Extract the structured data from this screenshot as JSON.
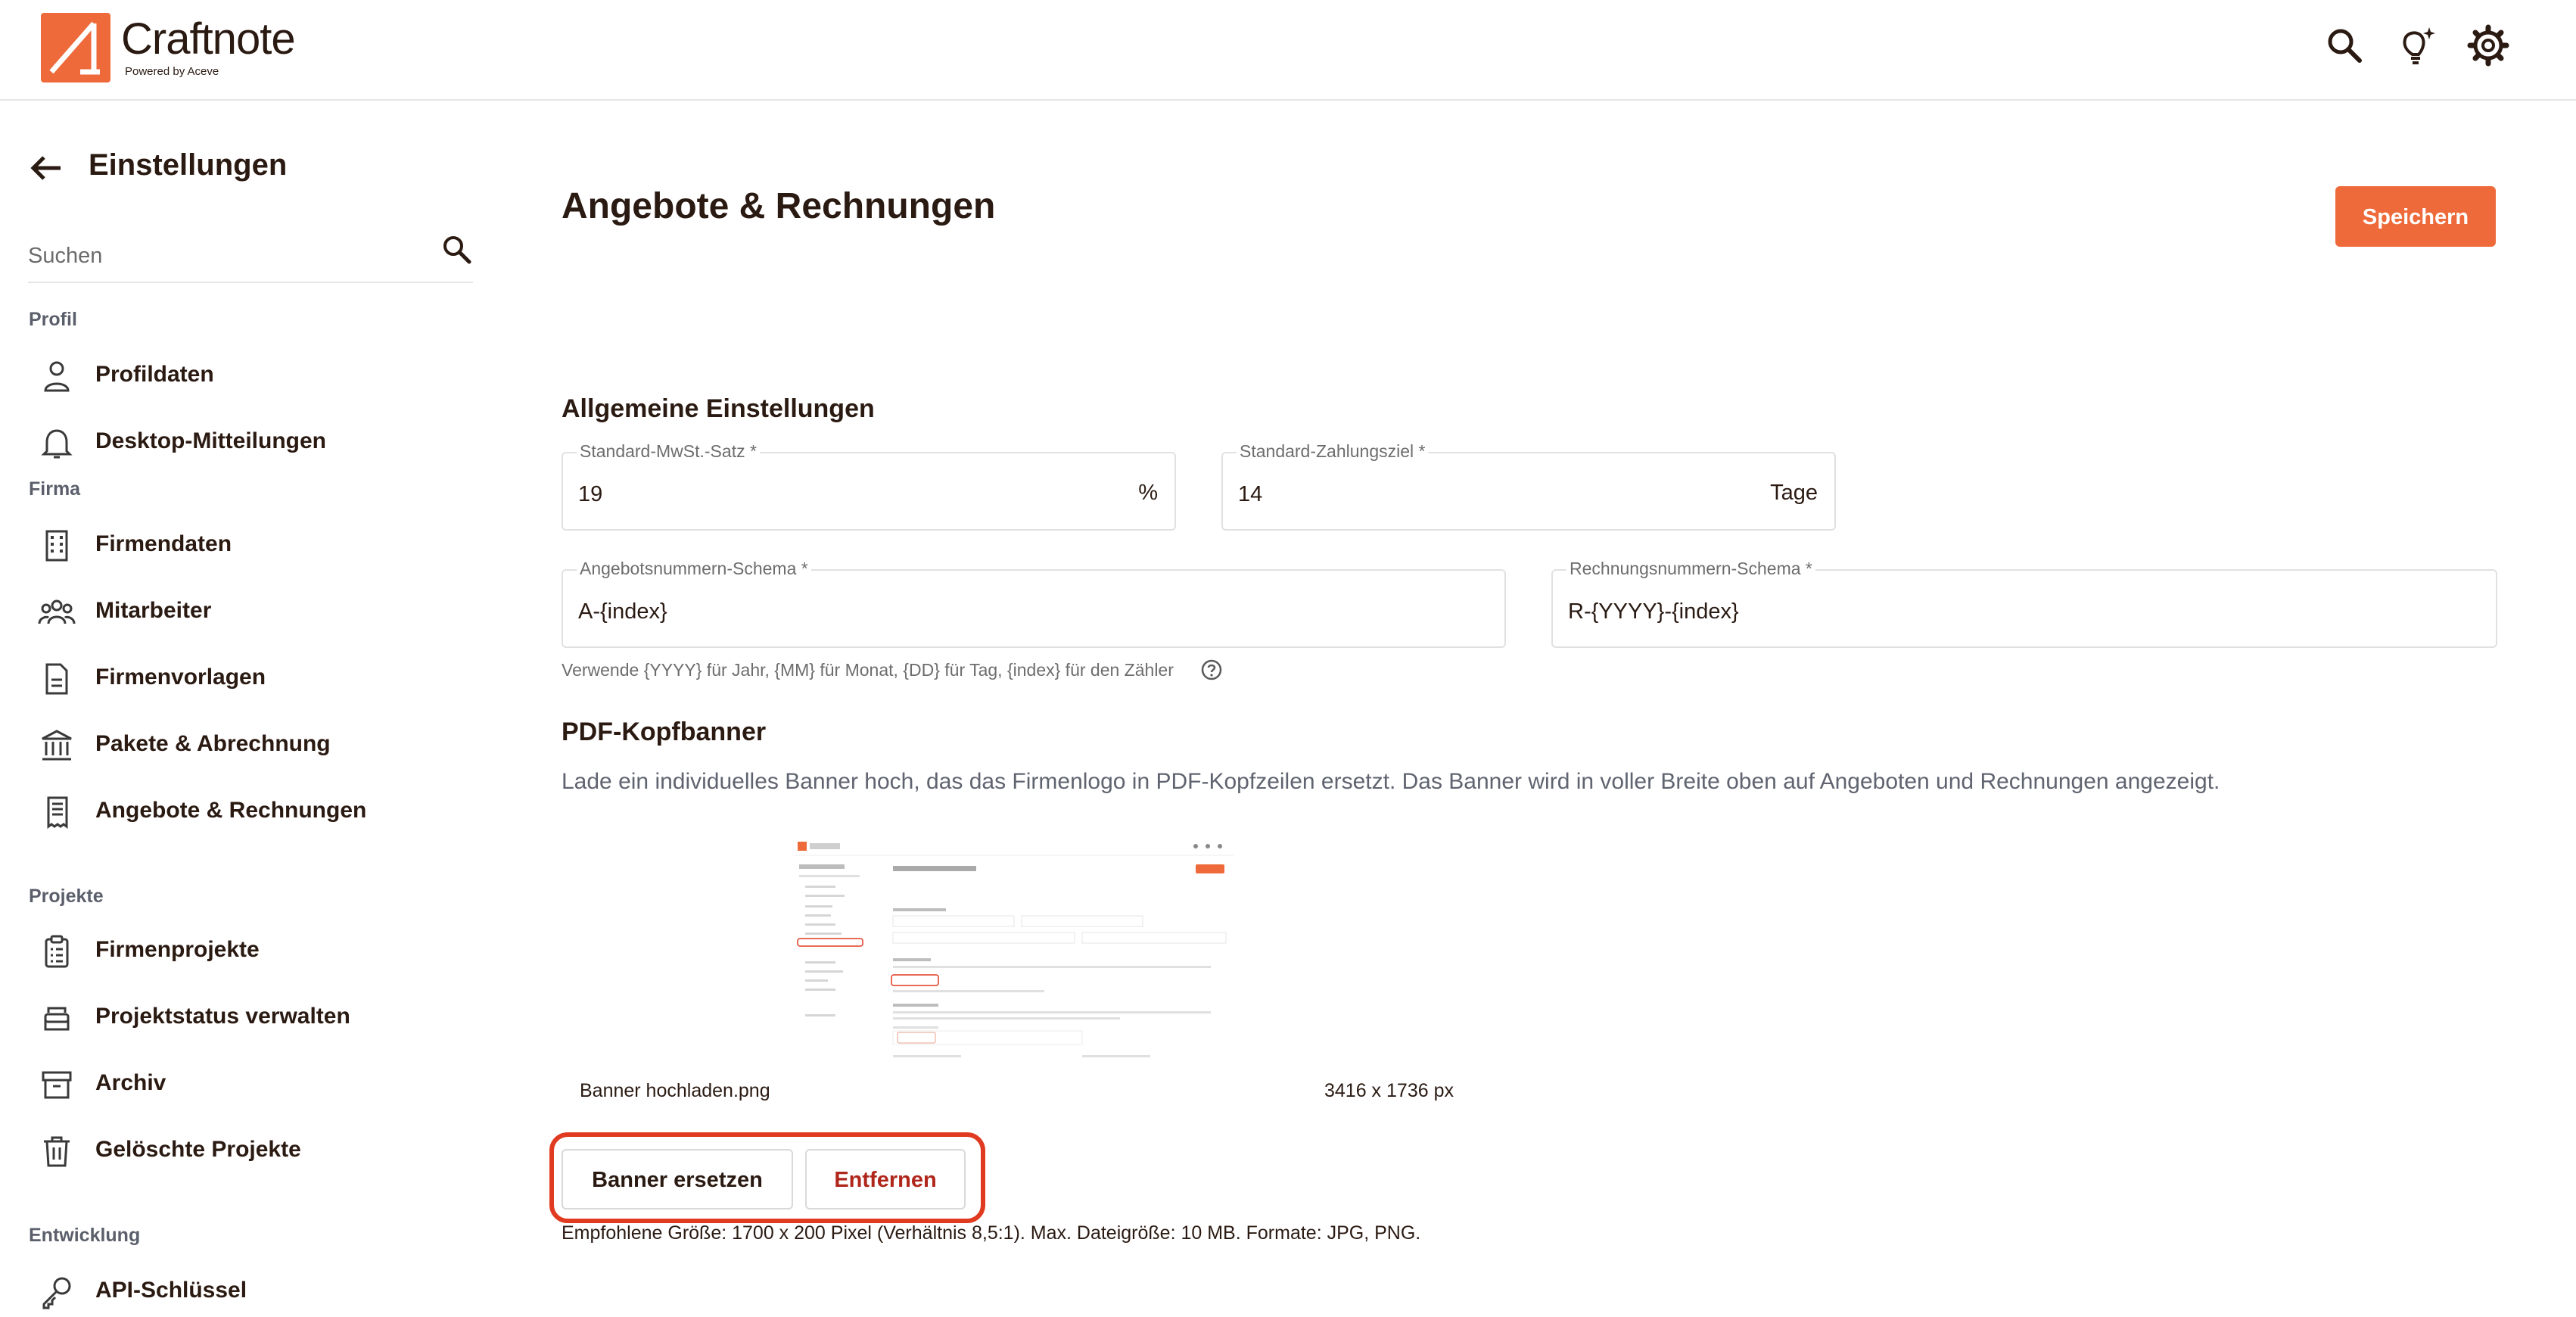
{
  "header": {
    "app_name": "Craftnote",
    "app_subtitle": "Powered by Aceve",
    "icons": [
      "search-icon",
      "lightbulb-icon",
      "gear-icon"
    ]
  },
  "sidebar": {
    "title": "Einstellungen",
    "search_placeholder": "Suchen",
    "sections": {
      "profil": "Profil",
      "firma": "Firma",
      "projekte": "Projekte",
      "entwicklung": "Entwicklung"
    },
    "items": [
      {
        "label": "Profildaten",
        "icon": "user-icon"
      },
      {
        "label": "Desktop-Mitteilungen",
        "icon": "bell-icon"
      },
      {
        "label": "Firmendaten",
        "icon": "building-icon"
      },
      {
        "label": "Mitarbeiter",
        "icon": "team-icon"
      },
      {
        "label": "Firmenvorlagen",
        "icon": "document-icon"
      },
      {
        "label": "Pakete & Abrechnung",
        "icon": "bank-icon"
      },
      {
        "label": "Angebote & Rechnungen",
        "icon": "receipt-icon"
      },
      {
        "label": "Firmenprojekte",
        "icon": "clipboard-icon"
      },
      {
        "label": "Projektstatus verwalten",
        "icon": "stack-icon"
      },
      {
        "label": "Archiv",
        "icon": "archive-icon"
      },
      {
        "label": "Gelöschte Projekte",
        "icon": "trash-icon"
      },
      {
        "label": "API-Schlüssel",
        "icon": "key-icon"
      }
    ]
  },
  "main": {
    "title": "Angebote & Rechnungen",
    "save_label": "Speichern",
    "general": {
      "heading": "Allgemeine Einstellungen",
      "vat_label": "Standard-MwSt.-Satz *",
      "vat_value": "19",
      "vat_suffix": "%",
      "payment_label": "Standard-Zahlungsziel *",
      "payment_value": "14",
      "payment_suffix": "Tage",
      "offer_schema_label": "Angebotsnummern-Schema *",
      "offer_schema_value": "A-{index}",
      "invoice_schema_label": "Rechnungsnummern-Schema *",
      "invoice_schema_value": "R-{YYYY}-{index}",
      "hint": "Verwende {YYYY} für Jahr, {MM} für Monat, {DD} für Tag, {index} für den Zähler"
    },
    "banner": {
      "heading": "PDF-Kopfbanner",
      "description": "Lade ein individuelles Banner hoch, das das Firmenlogo in PDF-Kopfzeilen ersetzt. Das Banner wird in voller Breite oben auf Angeboten und Rechnungen angezeigt.",
      "file_name": "Banner hochladen.png",
      "file_dimensions": "3416 x 1736 px",
      "replace_label": "Banner ersetzen",
      "remove_label": "Entfernen",
      "recommendation": "Empfohlene Größe: 1700 x 200 Pixel (Verhältnis 8,5:1). Max. Dateigröße: 10 MB. Formate: JPG, PNG."
    }
  },
  "colors": {
    "accent": "#ee6a3a",
    "danger_text": "#b0261b",
    "highlight_border": "#e03b20",
    "text_dark": "#2a1a12"
  }
}
